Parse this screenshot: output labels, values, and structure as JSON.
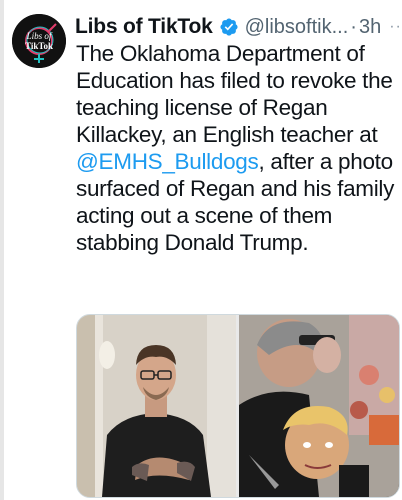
{
  "tweet": {
    "display_name": "Libs of TikTok",
    "handle": "@libsoftik...",
    "separator": "·",
    "time": "3h",
    "more": "···",
    "avatar_text_line1": "Libs of",
    "avatar_text_line2": "TikTok",
    "text_part1": "The Oklahoma Department of Education has filed to revoke the teaching license of Regan Killackey, an English teacher at ",
    "mention": "@EMHS_Bulldogs",
    "text_part2": ", after a photo surfaced of Regan and his family acting out a scene of them stabbing Donald Trump."
  },
  "colors": {
    "link": "#1d9bf0",
    "verified": "#1d9bf0",
    "muted": "#536471",
    "text": "#0f1419"
  },
  "icons": {
    "verified": "verified-badge-icon",
    "more": "more-options-icon"
  }
}
